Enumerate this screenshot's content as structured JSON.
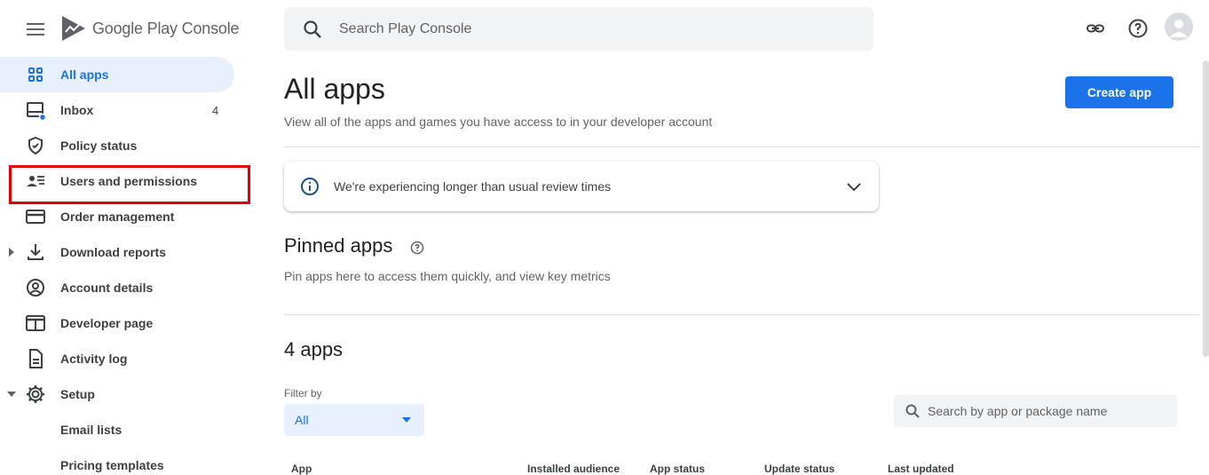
{
  "header": {
    "logo_text": "Google Play Console",
    "search_placeholder": "Search Play Console",
    "icons": [
      "menu-icon",
      "link-icon",
      "help-icon",
      "avatar"
    ]
  },
  "sidebar": {
    "items": [
      {
        "label": "All apps",
        "icon": "grid-icon",
        "active": true
      },
      {
        "label": "Inbox",
        "icon": "inbox-icon",
        "count": "4"
      },
      {
        "label": "Policy status",
        "icon": "shield-check-icon"
      },
      {
        "label": "Users and permissions",
        "icon": "people-list-icon",
        "highlighted": true
      },
      {
        "label": "Order management",
        "icon": "credit-card-icon"
      },
      {
        "label": "Download reports",
        "icon": "download-icon",
        "expandable": true
      },
      {
        "label": "Account details",
        "icon": "account-circle-icon"
      },
      {
        "label": "Developer page",
        "icon": "web-page-icon"
      },
      {
        "label": "Activity log",
        "icon": "document-icon"
      },
      {
        "label": "Setup",
        "icon": "gear-icon",
        "expanded": true
      },
      {
        "label": "Email lists"
      },
      {
        "label": "Pricing templates"
      }
    ]
  },
  "main": {
    "title": "All apps",
    "subtitle": "View all of the apps and games you have access to in your developer account",
    "create_button": "Create app",
    "notice": "We're experiencing longer than usual review times",
    "pinned_title": "Pinned apps",
    "pinned_subtitle": "Pin apps here to access them quickly, and view key metrics",
    "apps_count_title": "4 apps",
    "filter_label": "Filter by",
    "filter_value": "All",
    "app_search_placeholder": "Search by app or package name",
    "table_columns": [
      "App",
      "Installed audience",
      "App status",
      "Update status",
      "Last updated"
    ]
  },
  "colors": {
    "accent": "#1a73e8",
    "active_bg": "#e8f0fe",
    "highlight": "#e00000"
  }
}
